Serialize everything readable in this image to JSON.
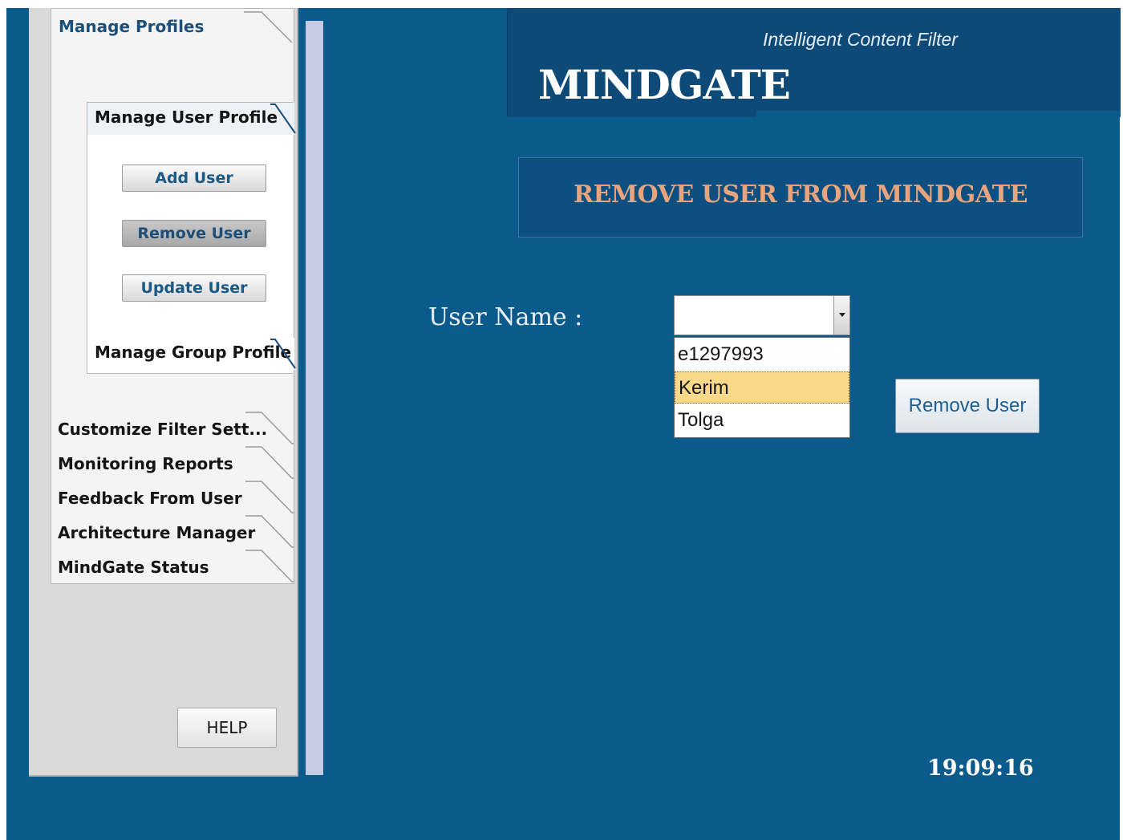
{
  "header": {
    "brand": "MINDGATE",
    "tagline": "Intelligent Content Filter"
  },
  "nav": {
    "manage_profiles": "Manage Profiles",
    "manage_user_profile": "Manage User Profile",
    "user_actions": {
      "add": "Add User",
      "remove": "Remove User",
      "update": "Update User"
    },
    "manage_group_profile": "Manage Group Profile",
    "sections": [
      "Customize Filter Sett...",
      "Monitoring Reports",
      "Feedback From User",
      "Architecture Manager",
      "MindGate Status"
    ],
    "help": "HELP"
  },
  "main": {
    "title": "REMOVE USER FROM MINDGATE",
    "user_label": "User Name :",
    "user_select": {
      "value": "",
      "options": [
        "e1297993",
        "Kerim",
        "Tolga"
      ],
      "highlighted": "Kerim"
    },
    "remove_button": "Remove User",
    "clock": "19:09:16"
  }
}
